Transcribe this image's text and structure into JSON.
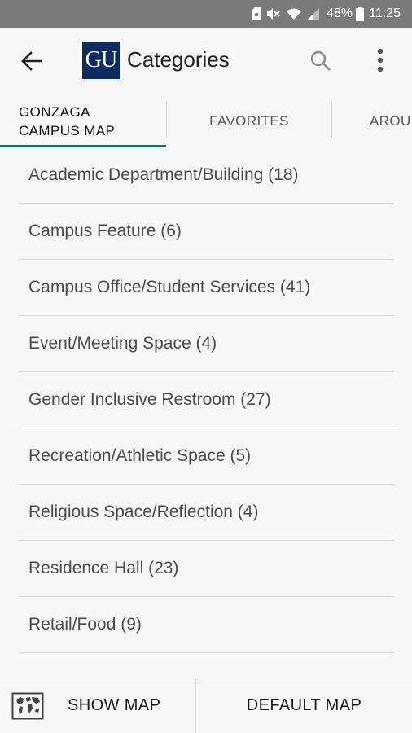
{
  "status_bar": {
    "battery_percent": "48%",
    "time": "11:25"
  },
  "app_bar": {
    "logo_text": "GU",
    "title": "Categories",
    "icons": [
      "back-arrow-icon",
      "search-icon",
      "more-vert-icon"
    ]
  },
  "tabs": [
    {
      "label": "GONZAGA\nCAMPUS MAP",
      "line1": "GONZAGA",
      "line2": "CAMPUS MAP",
      "selected": true
    },
    {
      "label": "FAVORITES",
      "selected": false
    },
    {
      "label": "AROU",
      "selected": false
    }
  ],
  "categories": [
    {
      "label": "Academic Department/Building (18)"
    },
    {
      "label": "Campus Feature (6)"
    },
    {
      "label": "Campus Office/Student Services (41)"
    },
    {
      "label": "Event/Meeting Space (4)"
    },
    {
      "label": "Gender Inclusive Restroom (27)"
    },
    {
      "label": "Recreation/Athletic Space (5)"
    },
    {
      "label": "Religious Space/Reflection (4)"
    },
    {
      "label": "Residence Hall (23)"
    },
    {
      "label": "Retail/Food (9)"
    }
  ],
  "bottom_bar": {
    "show_map_label": "SHOW MAP",
    "default_map_label": "DEFAULT MAP",
    "show_map_icon": "world-map-icon"
  },
  "colors": {
    "status_bar_bg": "#7a7a7a",
    "logo_bg": "#0f2c5e",
    "tab_indicator": "#1f6e5a",
    "background": "#f7f7f7"
  }
}
